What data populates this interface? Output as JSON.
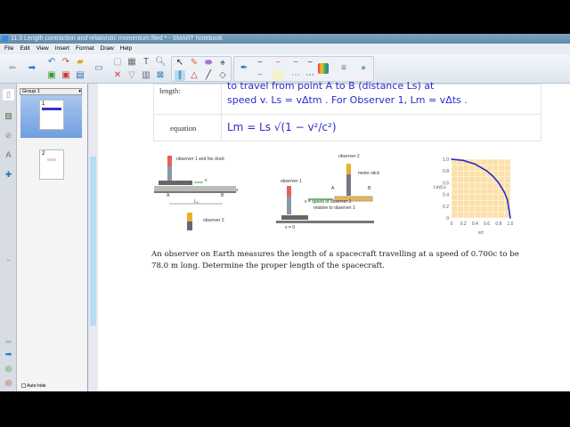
{
  "window": {
    "title": "11.3 Length contraction and relativistic momentum.filed * - SMART Notebook"
  },
  "menu": [
    "File",
    "Edit",
    "View",
    "Insert",
    "Format",
    "Draw",
    "Help"
  ],
  "sorter": {
    "group": "Group 1",
    "pages": [
      "1",
      "2"
    ],
    "autohide": "Auto-hide"
  },
  "table": {
    "row1_label": "length:",
    "row1_text_a": "to travel from point A to B (distance Ls) at",
    "row1_text_b": "speed v. Ls = vΔtm . For Observer 1, Lm = vΔts .",
    "row2_label": "equation",
    "row2_text": "Lm = Ls √(1 − v²/c²)"
  },
  "fig1": {
    "observer1": "observer 1 and his clock",
    "v": "v",
    "a": "A",
    "b": "B",
    "x": "x",
    "l": "L₀",
    "observer2": "observer 2"
  },
  "fig2": {
    "observer2": "observer 2",
    "stick": "metre stick",
    "observer1": "observer 1",
    "a": "A",
    "b": "B",
    "note1": "v = speed of observer 2",
    "note2": "relative to observer 1",
    "v0": "v = 0"
  },
  "chart_data": {
    "type": "line",
    "xlabel": "v/c",
    "ylabel": "Lm/Ls",
    "xticks": [
      "0",
      "0.2",
      "0.4",
      "0.6",
      "0.8",
      "1.0"
    ],
    "yticks": [
      "0",
      "0.2",
      "0.4",
      "0.6",
      "0.8",
      "1.0"
    ],
    "xlim": [
      0,
      1
    ],
    "ylim": [
      0,
      1
    ],
    "series": [
      {
        "name": "Lm/Ls",
        "x": [
          0,
          0.2,
          0.4,
          0.6,
          0.7,
          0.8,
          0.9,
          0.95,
          1.0
        ],
        "y": [
          1,
          0.98,
          0.917,
          0.8,
          0.714,
          0.6,
          0.436,
          0.312,
          0
        ]
      }
    ],
    "grid": true
  },
  "question": "An observer on Earth measures the length of a spacecraft travelling at a speed of 0.700c to be 78.0 m long. Determine the proper length of the spacecraft."
}
